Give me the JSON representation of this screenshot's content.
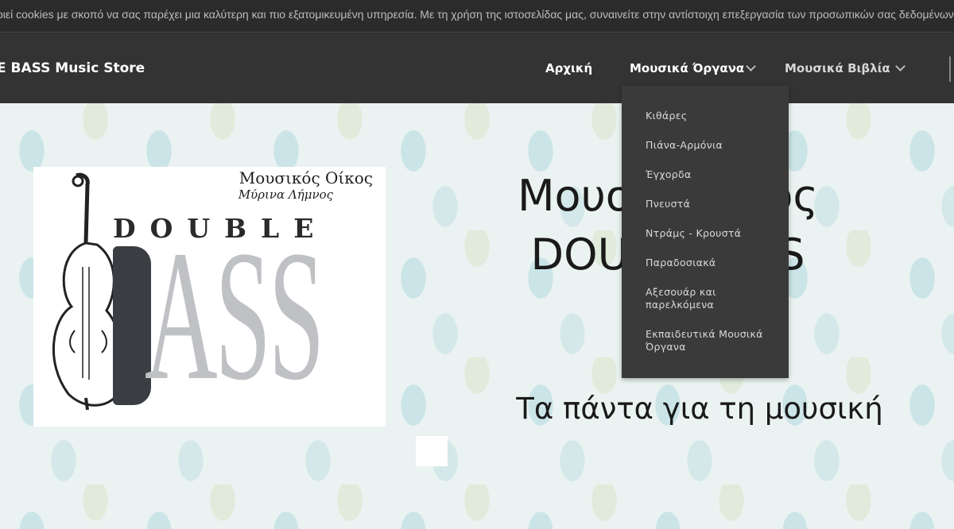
{
  "cookie_bar": {
    "text": "οιεί cookies με σκοπό να σας παρέχει μια καλύτερη και πιο εξατομικευμένη υπηρεσία. Με τη χρήση της ιστοσελίδας μας, συναινείτε στην αντίστοιχη επεξεργασία των προσωπικών σας δεδομένων"
  },
  "header": {
    "brand": "E BASS Music Store",
    "nav": {
      "home": "Αρχική",
      "instruments": "Μουσικά Όργανα",
      "books": "Μουσικά Βιβλία"
    }
  },
  "dropdown": {
    "items": [
      "Κιθάρες",
      "Πιάνα-Αρμόνια",
      "Έγχορδα",
      "Πνευστά",
      "Ντράμς - Κρουστά",
      "Παραδοσιακά",
      "Αξεσουάρ και παρελκόμενα",
      "Εκπαιδευτικά Μουσικά Όργανα"
    ]
  },
  "hero": {
    "title_line1": "Μουσι",
    "title_line1_end": "ος",
    "title_line2": "DOUB",
    "title_line2_end": "S",
    "subtitle": "Τα πάντα για τη μουσική"
  },
  "logo": {
    "line1": "Μουσικός Οίκος",
    "line2": "Μύρινα Λήμνος",
    "word1": "DOUBLE",
    "word2": "ASS"
  },
  "icons": {
    "chevron": "chevron-down-icon"
  }
}
